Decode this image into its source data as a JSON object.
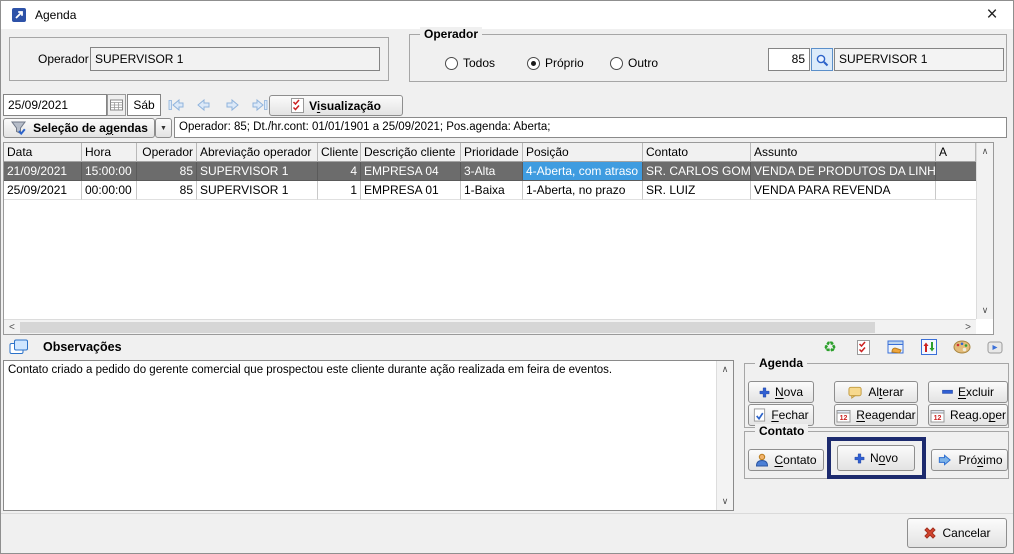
{
  "window": {
    "title": "Agenda",
    "close_glyph": "×"
  },
  "operator_panel": {
    "label": "Operador",
    "value": "SUPERVISOR 1"
  },
  "operator_group": {
    "legend": "Operador",
    "radios": [
      {
        "label": "Todos",
        "checked": "false"
      },
      {
        "label": "Próprio",
        "checked": "true"
      },
      {
        "label": "Outro",
        "checked": "false"
      }
    ],
    "code": "85",
    "name": "SUPERVISOR 1"
  },
  "toolbar": {
    "date": "25/09/2021",
    "weekday": "Sáb",
    "view_button": {
      "text": "Visualização",
      "accel": "i"
    },
    "selection_button": {
      "text": "Seleção de agendas",
      "accel": "g"
    },
    "dropdown_glyph": "▼",
    "filter_summary": "Operador: 85; Dt./hr.cont: 01/01/1901 a 25/09/2021; Pos.agenda: Aberta;"
  },
  "table": {
    "columns": [
      "Data",
      "Hora",
      "Operador",
      "Abreviação operador",
      "Cliente",
      "Descrição cliente",
      "Prioridade",
      "Posição",
      "Contato",
      "Assunto",
      "A"
    ],
    "rows": [
      {
        "selected": "true",
        "cells": [
          "21/09/2021",
          "15:00:00",
          "85",
          "SUPERVISOR 1",
          "4",
          "EMPRESA 04",
          "3-Alta",
          "4-Aberta, com atraso",
          "SR. CARLOS GOMES",
          "VENDA DE PRODUTOS DA LINHA \"SUPER\"",
          ""
        ]
      },
      {
        "selected": "false",
        "cells": [
          "25/09/2021",
          "00:00:00",
          "85",
          "SUPERVISOR 1",
          "1",
          "EMPRESA 01",
          "1-Baixa",
          "1-Aberta, no prazo",
          "SR. LUIZ",
          "VENDA PARA REVENDA",
          ""
        ]
      }
    ]
  },
  "scrollbars": {
    "up": "∧",
    "down": "∨",
    "left": "<",
    "right": ">"
  },
  "observations": {
    "title": "Observações",
    "text": "Contato criado a pedido do gerente comercial que prospectou este cliente durante ação realizada em feira de eventos."
  },
  "icons": {
    "strip": [
      "refresh-icon",
      "checklist-icon",
      "drag-agenda-icon",
      "sort-arrows-icon",
      "palette-icon",
      "shortcut-key-icon"
    ],
    "refresh_glyph": "♻"
  },
  "agenda_group": {
    "legend": "Agenda",
    "buttons": {
      "nova": {
        "text": "Nova",
        "accel": "N"
      },
      "alterar": {
        "text": "Alterar",
        "accel": "t"
      },
      "excluir": {
        "text": "Excluir",
        "accel": "E"
      },
      "fechar": {
        "text": "Fechar",
        "accel": "F"
      },
      "reagendar": {
        "text": "Reagendar",
        "accel": "R"
      },
      "reag_oper": {
        "text": "Reag.oper",
        "accel": "p"
      }
    }
  },
  "contato_group": {
    "legend": "Contato",
    "buttons": {
      "contato": {
        "text": "Contato",
        "accel": "C"
      },
      "novo": {
        "text": "Novo",
        "accel": "o"
      },
      "proximo": {
        "text": "Próximo",
        "accel": "x"
      }
    }
  },
  "footer": {
    "cancel": {
      "text": "Cancelar",
      "accel": ""
    }
  },
  "colors": {
    "selected_row_bg": "#6c6c6c",
    "selected_cell_bg": "#3f9ce0",
    "highlight_border": "#1c2a6e",
    "accent_blue": "#2f5fd3",
    "accent_red": "#cc2222",
    "accent_green": "#2ca02c"
  }
}
